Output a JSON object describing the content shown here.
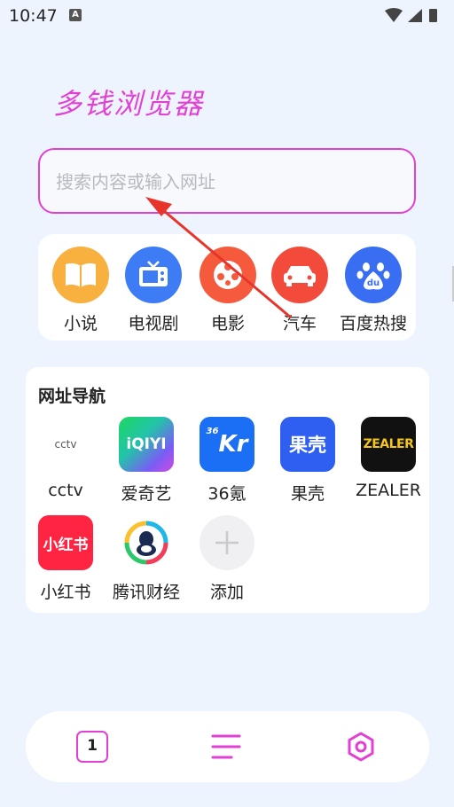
{
  "status_bar": {
    "time": "10:47",
    "a_glyph": "A"
  },
  "brand": {
    "title": "多钱浏览器"
  },
  "search": {
    "placeholder": "搜索内容或输入网址"
  },
  "quick_links": [
    {
      "label": "小说",
      "icon": "book-icon",
      "color": "#f8b03e"
    },
    {
      "label": "电视剧",
      "icon": "tv-icon",
      "color": "#3d7cf5"
    },
    {
      "label": "电影",
      "icon": "film-reel-icon",
      "color": "#f55a3d"
    },
    {
      "label": "汽车",
      "icon": "car-icon",
      "color": "#f24b3c"
    },
    {
      "label": "百度热搜",
      "icon": "baidu-paw-icon",
      "color": "#3a6ef2"
    }
  ],
  "nav": {
    "title": "网址导航",
    "items": [
      {
        "label": "cctv",
        "logo": "cctv"
      },
      {
        "label": "爱奇艺",
        "logo": "iQIYI"
      },
      {
        "label": "36氪",
        "logo_sup": "36",
        "logo_main": "Kr"
      },
      {
        "label": "果壳",
        "logo": "果壳"
      },
      {
        "label": "ZEALER",
        "logo": "ZEALER"
      },
      {
        "label": "小红书",
        "logo": "小红书"
      },
      {
        "label": "腾讯财经",
        "logo": "tencent-finance"
      },
      {
        "label": "添加",
        "logo": "plus"
      }
    ]
  },
  "bottom": {
    "tab_count": "1"
  },
  "colors": {
    "accent": "#e23fd5",
    "background": "#eef4fd"
  }
}
